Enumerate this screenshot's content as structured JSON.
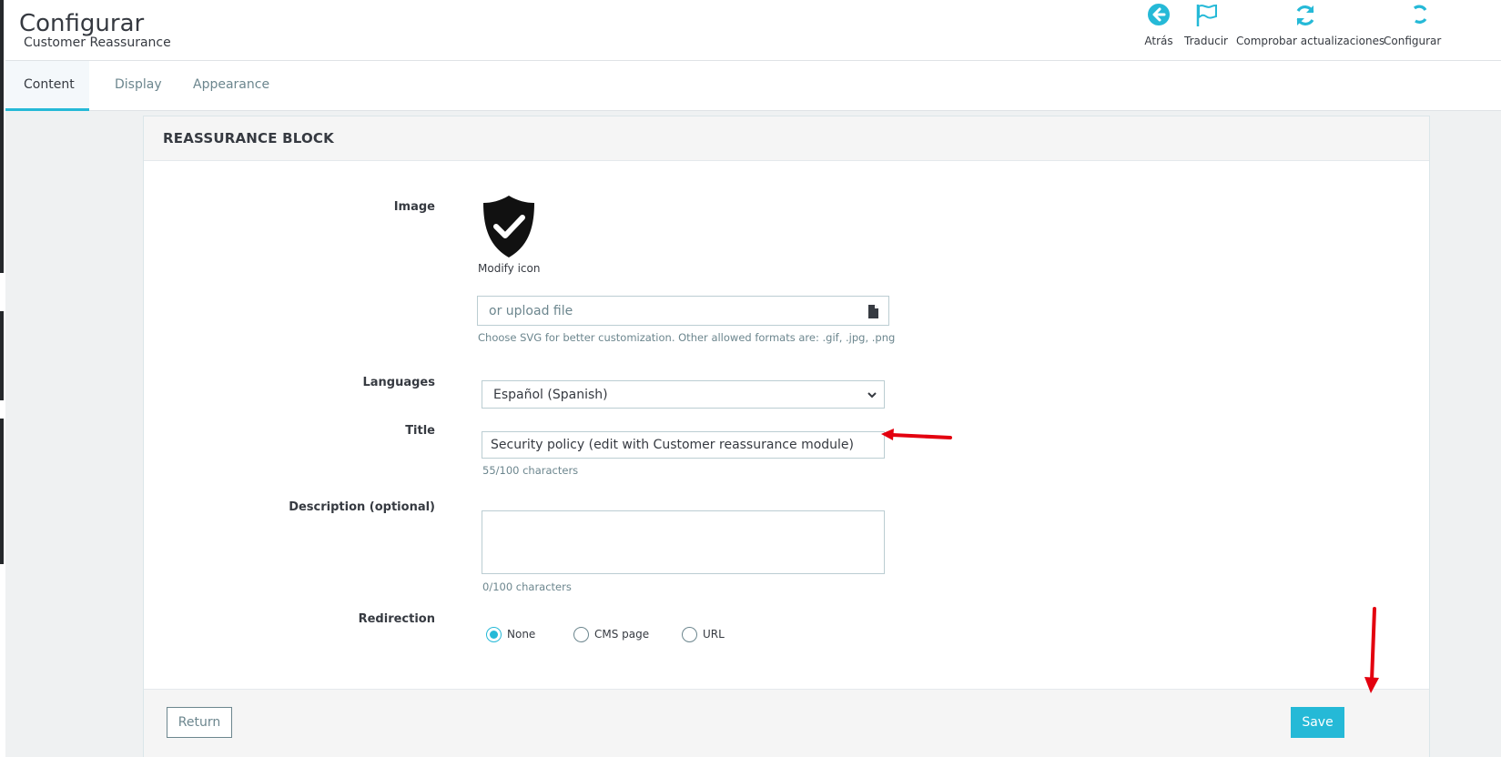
{
  "header": {
    "title": "Configurar",
    "subtitle": "Customer Reassurance",
    "toolbar": [
      {
        "label": "Atrás",
        "icon": "back-circle-icon"
      },
      {
        "label": "Traducir",
        "icon": "flag-icon"
      },
      {
        "label": "Comprobar actualizaciones",
        "icon": "refresh-icon"
      },
      {
        "label": "Configurar",
        "icon": "configure-icon"
      }
    ]
  },
  "tabs": [
    {
      "label": "Content",
      "active": true
    },
    {
      "label": "Display",
      "active": false
    },
    {
      "label": "Appearance",
      "active": false
    }
  ],
  "panel": {
    "title": "REASSURANCE BLOCK",
    "image": {
      "label": "Image",
      "icon": "shield-check-icon",
      "modify_label": "Modify icon",
      "upload_placeholder": "or upload file",
      "hint": "Choose SVG for better customization. Other allowed formats are: .gif, .jpg, .png"
    },
    "languages": {
      "label": "Languages",
      "selected": "Español (Spanish)"
    },
    "title_field": {
      "label": "Title",
      "value": "Security policy (edit with Customer reassurance module)",
      "counter": "55/100 characters"
    },
    "description": {
      "label": "Description (optional)",
      "value": "",
      "counter": "0/100 characters"
    },
    "redirection": {
      "label": "Redirection",
      "options": [
        {
          "label": "None",
          "checked": true
        },
        {
          "label": "CMS page",
          "checked": false
        },
        {
          "label": "URL",
          "checked": false
        }
      ]
    },
    "footer": {
      "return_label": "Return",
      "save_label": "Save"
    }
  },
  "colors": {
    "accent": "#25b9d7",
    "annotation_arrow": "#e3000f"
  }
}
